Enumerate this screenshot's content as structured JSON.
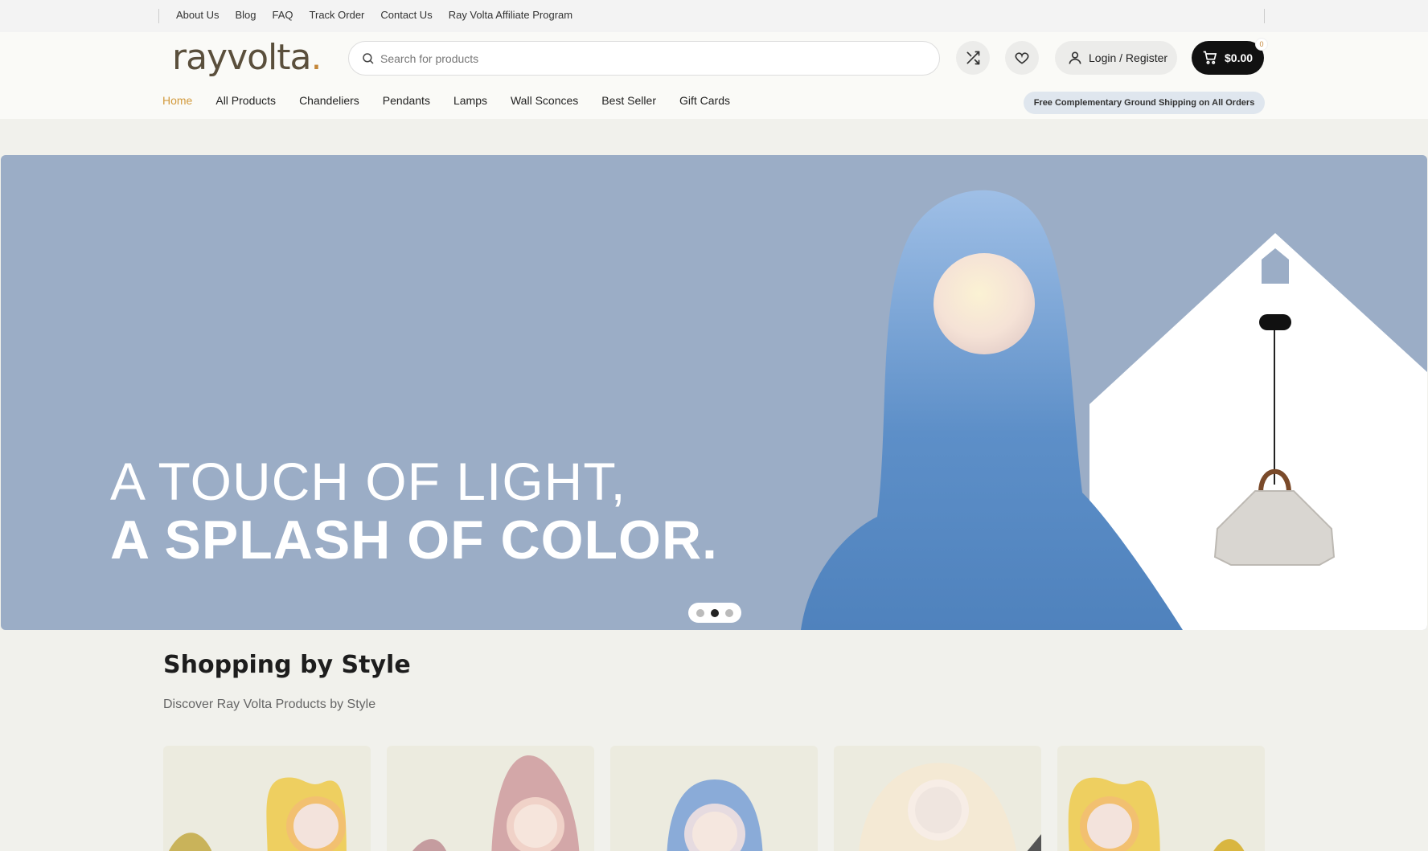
{
  "topbar": {
    "links": [
      "About Us",
      "Blog",
      "FAQ",
      "Track Order",
      "Contact Us",
      "Ray Volta Affiliate Program"
    ]
  },
  "header": {
    "logo_text": "rayvolta",
    "logo_dot": ".",
    "search_placeholder": "Search for products",
    "login_label": "Login / Register",
    "cart_amount": "$0.00",
    "cart_count": "0",
    "nav": [
      "Home",
      "All Products",
      "Chandeliers",
      "Pendants",
      "Lamps",
      "Wall Sconces",
      "Best Seller",
      "Gift Cards"
    ],
    "active_nav": "Home",
    "shipping_note": "Free Complementary Ground Shipping on All Orders"
  },
  "hero": {
    "line1": "A TOUCH OF LIGHT,",
    "line2": "A SPLASH OF COLOR.",
    "slide_count": 3,
    "active_slide": 2
  },
  "section": {
    "title": "Shopping by Style",
    "subtitle": "Discover Ray Volta Products by Style",
    "cards": [
      {
        "icon": "yellow-lamp-icon"
      },
      {
        "icon": "pink-lamp-icon"
      },
      {
        "icon": "blue-lamp-icon"
      },
      {
        "icon": "white-lamp-icon"
      },
      {
        "icon": "yellow-lamp-icon"
      }
    ]
  },
  "colors": {
    "accent": "#d29a3d",
    "hero_bg": "#9badc6",
    "cart_bg": "#111111"
  }
}
